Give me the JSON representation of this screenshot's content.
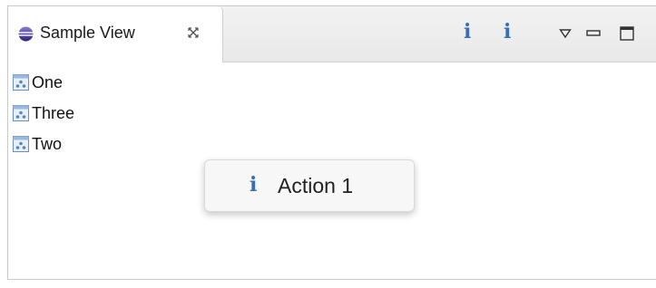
{
  "view": {
    "title": "Sample View",
    "icon": "eclipse-view-icon",
    "close_icon": "close-icon"
  },
  "toolbar": {
    "info1_glyph": "i",
    "info2_glyph": "i",
    "info1_icon": "info-icon",
    "info2_icon": "info-icon",
    "menu_icon": "view-menu-icon",
    "minimize_icon": "minimize-icon",
    "maximize_icon": "maximize-icon",
    "accent_color": "#3a6fb5"
  },
  "tree": {
    "items": [
      {
        "label": "One",
        "icon": "object-icon"
      },
      {
        "label": "Three",
        "icon": "object-icon"
      },
      {
        "label": "Two",
        "icon": "object-icon"
      }
    ]
  },
  "context_menu": {
    "items": [
      {
        "label": "Action 1",
        "icon_glyph": "i",
        "icon": "info-icon"
      }
    ]
  }
}
